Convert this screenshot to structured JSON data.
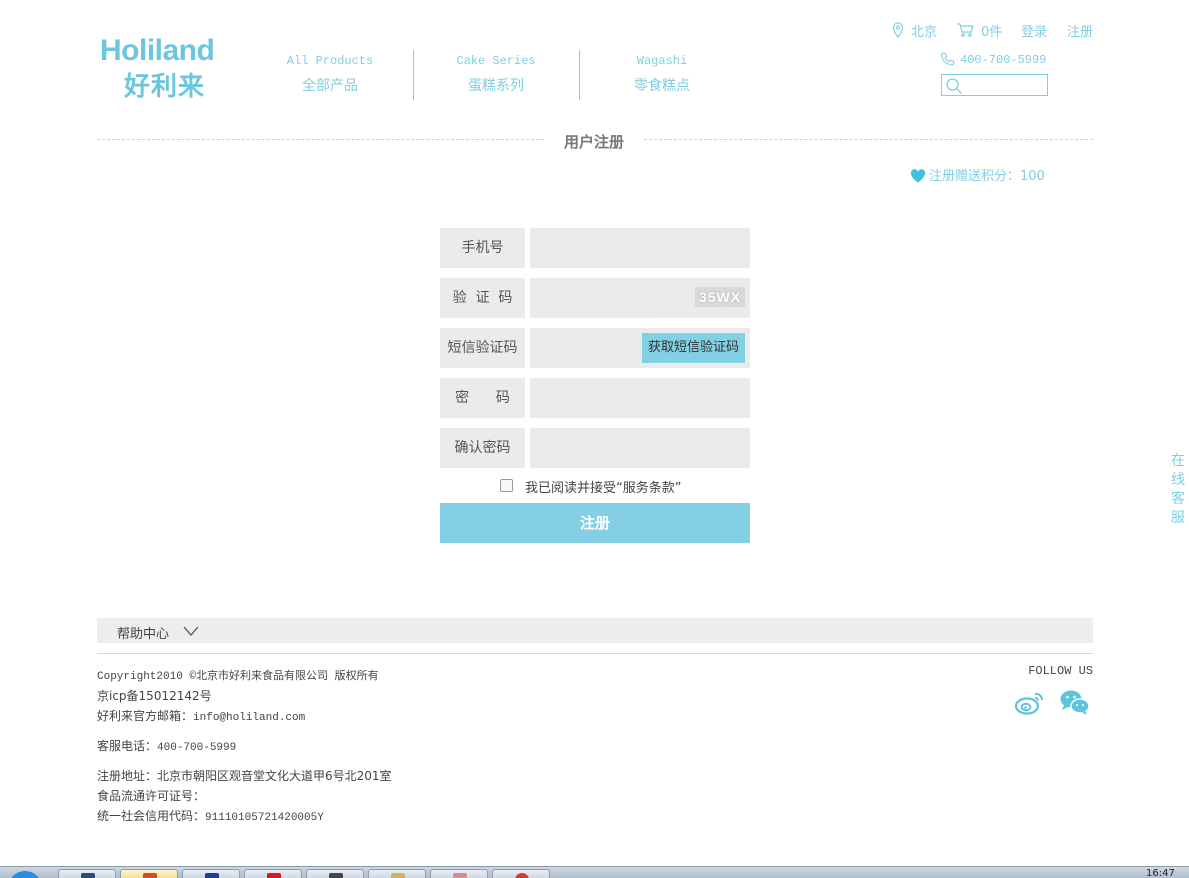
{
  "header": {
    "logo_en": "Holiland",
    "logo_cn": "好利来",
    "nav": [
      {
        "en": "All Products",
        "cn": "全部产品"
      },
      {
        "en": "Cake Series",
        "cn": "蛋糕系列"
      },
      {
        "en": "Wagashi",
        "cn": "零食糕点"
      }
    ],
    "city": "北京",
    "cart": "0件",
    "login": "登录",
    "register": "注册",
    "phone": "400-700-5999"
  },
  "page": {
    "title": "用户注册",
    "bonus": "注册赠送积分：100"
  },
  "form": {
    "rows": [
      {
        "label": "手机号",
        "value": ""
      },
      {
        "label": "验  证  码",
        "value": "",
        "captcha": "35WX"
      },
      {
        "label": "短信验证码",
        "value": "",
        "button": "获取短信验证码"
      },
      {
        "label": "密      码",
        "value": ""
      },
      {
        "label": "确认密码",
        "value": ""
      }
    ],
    "agree": "我已阅读并接受“服务条款”",
    "submit": "注册"
  },
  "footer": {
    "help": "帮助中心",
    "copyright": "Copyright2010 ©北京市好利来食品有限公司 版权所有",
    "icp": "京icp备15012142号",
    "email_label": "好利来官方邮箱：",
    "email": "info@holiland.com",
    "tel_label": "客服电话：",
    "tel": "400-700-5999",
    "address": "注册地址：北京市朝阳区观音堂文化大道甲6号北201室",
    "license": "食品流通许可证号：",
    "credit_label": "统一社会信用代码：",
    "credit": "911101057214200​05Y",
    "follow": "FOLLOW US"
  },
  "sidebar": {
    "service": "在线客服"
  },
  "taskbar": {
    "clock": "16:47"
  }
}
